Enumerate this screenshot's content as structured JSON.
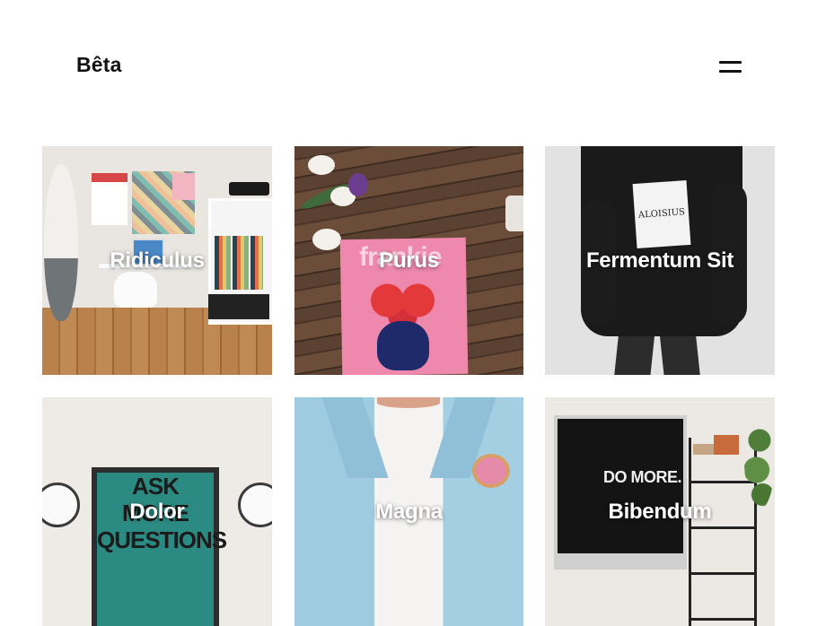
{
  "header": {
    "logo": "Bêta",
    "menu_icon": "hamburger-menu-icon"
  },
  "gallery": {
    "items": [
      {
        "title": "Ridiculus"
      },
      {
        "title": "Purus",
        "image_text": "frankie"
      },
      {
        "title": "Fermentum Sit",
        "image_text": "ALOISIUS"
      },
      {
        "title": "Dolor",
        "image_text": "ASK MORE QUESTIONS"
      },
      {
        "title": "Magna"
      },
      {
        "title": "Bibendum",
        "image_text": "DO MORE."
      }
    ]
  },
  "colors": {
    "background": "#ffffff",
    "text": "#111111",
    "overlay_text": "#ffffff"
  }
}
